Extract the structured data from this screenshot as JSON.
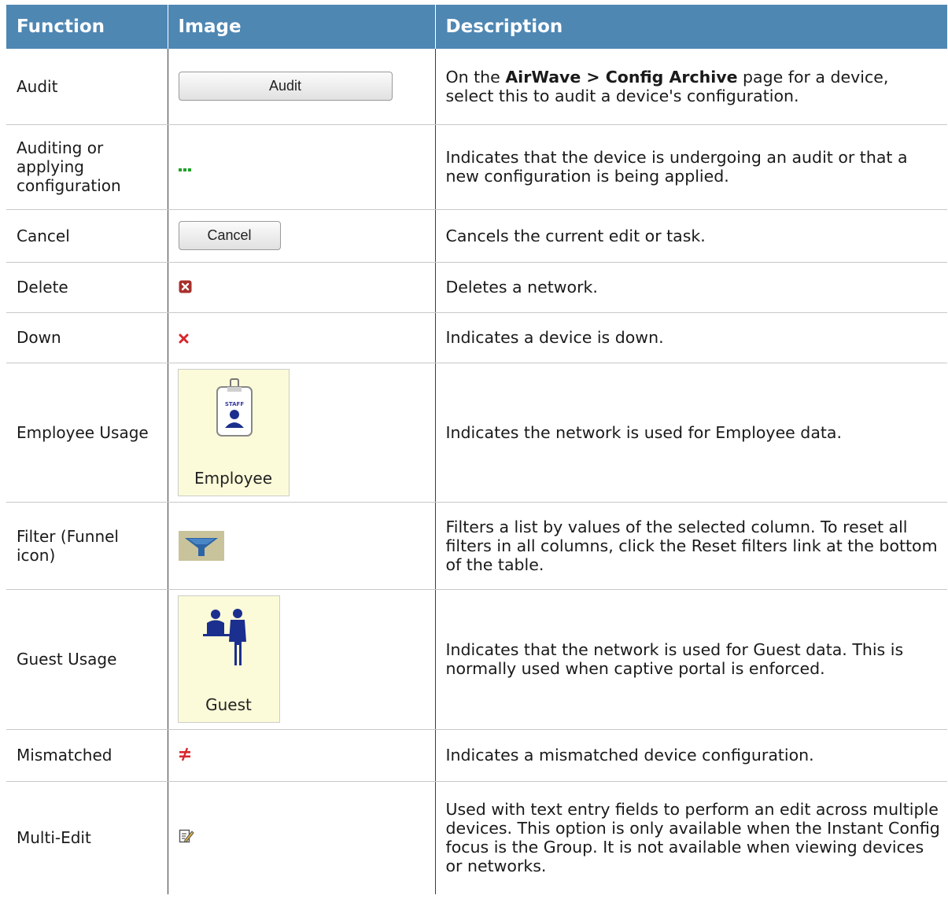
{
  "header": {
    "function": "Function",
    "image": "Image",
    "description": "Description"
  },
  "rows": {
    "audit": {
      "function": "Audit",
      "button_label": "Audit",
      "desc_prefix": "On the ",
      "desc_bold": "AirWave > Config Archive",
      "desc_suffix": " page for a device, select this to audit a device's configuration."
    },
    "auditing": {
      "function": "Auditing or applying configuration",
      "icon": "green-dots-icon",
      "description": "Indicates that the device is undergoing an audit or that a new configuration is being applied."
    },
    "cancel": {
      "function": "Cancel",
      "button_label": "Cancel",
      "description": "Cancels the current edit or task."
    },
    "delete": {
      "function": "Delete",
      "icon": "delete-x-box-icon",
      "description": "Deletes a network."
    },
    "down": {
      "function": "Down",
      "icon": "red-x-icon",
      "description": "Indicates a device is down."
    },
    "employee": {
      "function": "Employee Usage",
      "badge_text": "STAFF",
      "image_label": "Employee",
      "description": "Indicates the network is used for Employee data."
    },
    "filter": {
      "function": "Filter (Funnel icon)",
      "icon": "funnel-icon",
      "description": "Filters a list by values of the selected column. To reset all filters in all columns, click the Reset filters link at the bottom of the table."
    },
    "guest": {
      "function": "Guest Usage",
      "image_label": "Guest",
      "description": "Indicates that the network is used for Guest data. This is normally used when captive portal is enforced."
    },
    "mismatched": {
      "function": "Mismatched",
      "icon": "not-equal-icon",
      "description": "Indicates a mismatched device configuration."
    },
    "multiedit": {
      "function": "Multi-Edit",
      "icon": "edit-note-icon",
      "description": "Used with text entry fields to perform an edit across multiple devices. This option is only available when the Instant Config focus is the Group. It is not available when viewing devices or networks."
    }
  },
  "colors": {
    "header_bg": "#4f87b3",
    "green": "#1fa32a",
    "red": "#d7262d",
    "delete_red": "#a8302b",
    "funnel_blue": "#2d64a6",
    "usage_bg": "#fbfbd9",
    "figure_blue": "#1b2f8e"
  }
}
